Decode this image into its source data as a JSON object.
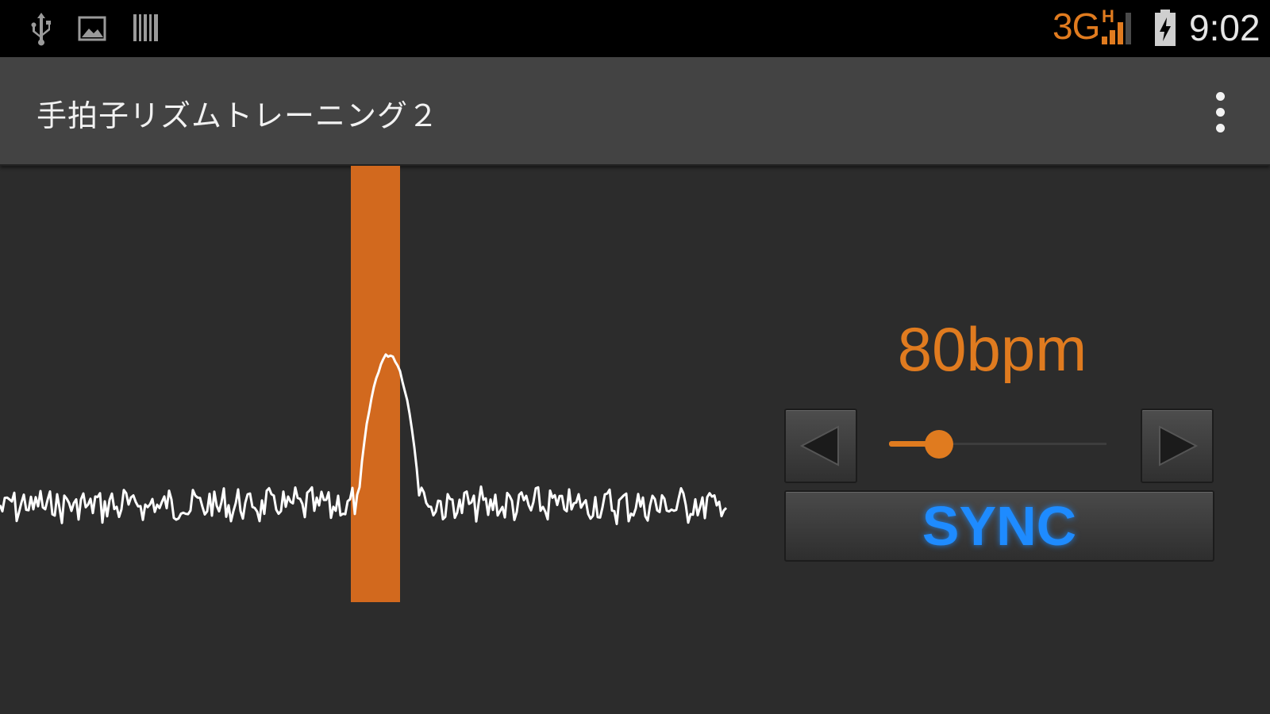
{
  "status_bar": {
    "icons": [
      "usb-icon",
      "image-icon",
      "barcode-icon",
      "signal-icon",
      "battery-charging-icon"
    ],
    "network": "3G",
    "network_sub": "H",
    "time": "9:02"
  },
  "action_bar": {
    "title": "手拍子リズムトレーニング２"
  },
  "tempo": {
    "bpm_label": "80bpm",
    "slider_level": 0.23
  },
  "controls": {
    "sync_label": "SYNC"
  },
  "colors": {
    "accent": "#e07b1f",
    "sync_text": "#1e8bff",
    "background": "#2c2c2c",
    "action_bar": "#434343"
  }
}
